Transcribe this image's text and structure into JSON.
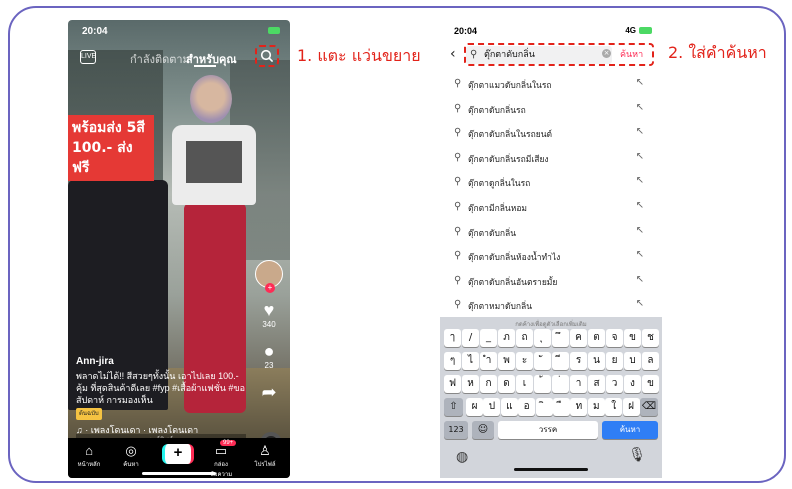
{
  "left_phone": {
    "status_time": "20:04",
    "tabs": {
      "following": "กำลังติดตาม",
      "for_you": "สำหรับคุณ"
    },
    "promo": [
      "พร้อมส่ง 5สี",
      "100.- ส่งฟรี"
    ],
    "caption": {
      "user": "Ann-jira",
      "text": "พลาดไม่ได้!! สีสวยๆทั้งนั้น เอาไปเลย 100.- คุ้ม ที่สุดสินค้าดีเลย #fyp #เสื้อผ้าแฟชั่น #ขอสัปดาห์ การมองเห็น",
      "chip": "ต้นฉบับ",
      "music": "♫ · เพลงโดนเดา · เพลงโดนเดา",
      "playlist": "เพลย์ลิสต์ ›"
    },
    "side": {
      "likes": "340",
      "comments": "23"
    },
    "nav": {
      "home": "หน้าหลัก",
      "discover": "ค้นหา",
      "inbox": "กล่องข้อความ",
      "profile": "โปรไฟล์",
      "inbox_badge": "99+"
    }
  },
  "annotations": {
    "step1": "1. แตะ แว่นขยาย",
    "step2": "2. ใส่คำค้นหา"
  },
  "right_phone": {
    "status_time": "20:04",
    "status_signal": "4G",
    "search_value": "ตุ๊กตาดับกลิ่น",
    "search_button": "ค้นหา",
    "suggestions": [
      "ตุ๊กตาแมวดับกลิ่นในรถ",
      "ตุ๊กตาดับกลิ่นรถ",
      "ตุ๊กตาดับกลิ่นในรถยนต์",
      "ตุ๊กตาดับกลิ่นรถมีเสียง",
      "ตุ๊กตาดูกลิ่นในรถ",
      "ตุ๊กตามีกลิ่นหอม",
      "ตุ๊กตาดับกลิ่น",
      "ตุ๊กตาดับกลิ่นห้องน้ำทำไง",
      "ตุ๊กตาดับกลิ่นอันตรายมั้ย",
      "ตุ๊กตาหมาดับกลิ่น"
    ],
    "keyboard": {
      "hint": "กดค้างเพื่อดูตัวเลือกเพิ่มเติม",
      "row1": [
        "ๅ",
        "/",
        "_",
        "ภ",
        "ถ",
        "ุ",
        "ึ",
        "ค",
        "ต",
        "จ",
        "ข",
        "ช"
      ],
      "row2": [
        "ๆ",
        "ไ",
        "ำ",
        "พ",
        "ะ",
        "ั",
        "ี",
        "ร",
        "น",
        "ย",
        "บ",
        "ล"
      ],
      "row3": [
        "ฟ",
        "ห",
        "ก",
        "ด",
        "เ",
        "้",
        "่",
        "า",
        "ส",
        "ว",
        "ง",
        "ข"
      ],
      "row4": [
        "ผ",
        "ป",
        "แ",
        "อ",
        "ิ",
        "ื",
        "ท",
        "ม",
        "ใ",
        "ฝ"
      ],
      "num": "123",
      "space": "วรรค",
      "go": "ค้นหา"
    }
  }
}
